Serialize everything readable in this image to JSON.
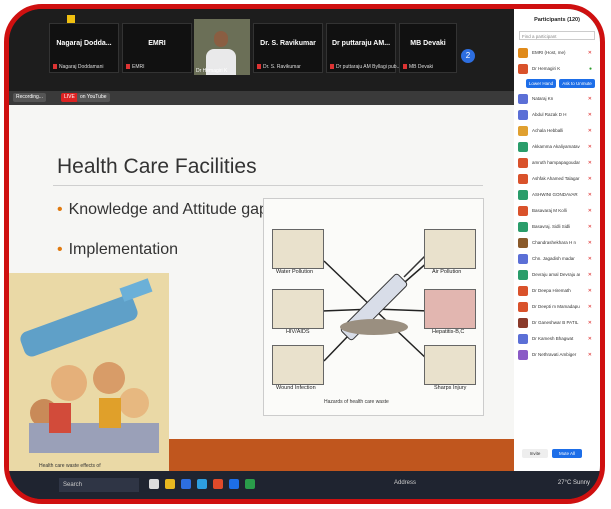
{
  "video_strip": {
    "tiles": [
      {
        "name": "Nagaraj Dodda...",
        "sub": "Nagaraj Doddamani"
      },
      {
        "name": "EMRI",
        "sub": "EMRI"
      },
      {
        "name": "",
        "sub": "Dr Hemagiri K"
      },
      {
        "name": "Dr. S. Ravikumar",
        "sub": "Dr. S. Ravikumar"
      },
      {
        "name": "Dr puttaraju AM...",
        "sub": "Dr puttaraju AM Byllagi pub..."
      },
      {
        "name": "MB Devaki",
        "sub": "MB Devaki"
      }
    ],
    "more_label": "2"
  },
  "toolbar": {
    "recording": "Recording...",
    "live": "LIVE",
    "youtube": "on YouTube"
  },
  "slide": {
    "title": "Health Care Facilities",
    "bullets": [
      "Knowledge and Attitude gap",
      "Implementation"
    ],
    "hazard_labels": [
      "Water Pollution",
      "Air Pollution",
      "HIV/AIDS",
      "Hepatitis-B,C",
      "Wound Infection",
      "Sharps Injury"
    ],
    "hazard_caption": "Hazards of health care waste",
    "cartoon_caption": "Health care waste effects of"
  },
  "participants": {
    "header": "Participants (120)",
    "search_placeholder": "Find a participant",
    "lower_hand": "Lower Hand",
    "ask_unmute": "Ask to Unmute",
    "list": [
      {
        "name": "EMRI (Host, me)",
        "color": "#e08a1a"
      },
      {
        "name": "Dr Hemagiri K",
        "color": "#d9522b"
      },
      {
        "name": "Nataraj Kn",
        "color": "#5b6fd6"
      },
      {
        "name": "Abdul Razak D H",
        "color": "#5b6fd6"
      },
      {
        "name": "Achala Hebballi",
        "color": "#e0a030"
      },
      {
        "name": "Akkamma Akaliyamatavar",
        "color": "#2a9d6a"
      },
      {
        "name": "amruth hampapagoudar",
        "color": "#d9522b"
      },
      {
        "name": "Ashfak Ahamed Talagar Talagar",
        "color": "#d9522b"
      },
      {
        "name": "ASHWINI GONDAVAR",
        "color": "#2a9d6a"
      },
      {
        "name": "Basavaraj M Kolli",
        "color": "#d9522b"
      },
      {
        "name": "Basavraj. Sidli Sidli",
        "color": "#2a9d6a"
      },
      {
        "name": "Chandrashekhara H n",
        "color": "#8a5a2a"
      },
      {
        "name": "Chn. Jagadish madar",
        "color": "#5b6fd6"
      },
      {
        "name": "Devraju amal Devraju amal",
        "color": "#2a9d6a"
      },
      {
        "name": "Dr Deepa Hiremath",
        "color": "#d9522b"
      },
      {
        "name": "Dr Deepti m Mamadapur",
        "color": "#d9522b"
      },
      {
        "name": "Dr Ganeshwar B PATIL",
        "color": "#8a3a2a"
      },
      {
        "name": "Dr Kamesh Bhagwat",
        "color": "#5b6fd6"
      },
      {
        "name": "Dr Nethravati Ambiger",
        "color": "#8a5ac6"
      }
    ],
    "invite": "Invite",
    "mute_all": "Mute All"
  },
  "taskbar": {
    "search_placeholder": "Search",
    "address": "Address",
    "weather": "27°C Sunny",
    "time": ""
  }
}
